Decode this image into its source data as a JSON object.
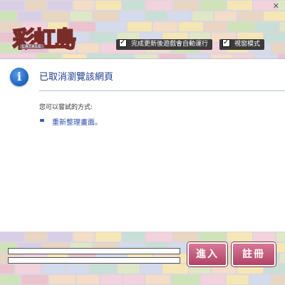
{
  "colors": {
    "brick_palette": [
      "#f2d2dd",
      "#cfe3b8",
      "#e8d5c2",
      "#d3dbec",
      "#f5e7b5",
      "#d8cfe6",
      "#eac3cf",
      "#c7dfd6",
      "#f3ddc9",
      "#dfe8c6"
    ],
    "accent": "#b24365",
    "link": "#2d4ea8"
  },
  "header": {
    "logo_text": "彩虹島",
    "logo_subtext": "LATALE",
    "option_autorun": {
      "label": "完成更新後遊戲會自動運行",
      "checked": true
    },
    "option_window": {
      "label": "視窗模式",
      "checked": true
    },
    "close_glyph": "✕"
  },
  "content": {
    "icon": "info-icon",
    "icon_glyph": "i",
    "heading": "已取消瀏覽該網頁",
    "suggestion": "您可以嘗試的方式:",
    "link_text": "重新整理畫面。"
  },
  "footer": {
    "enter_button": "進入",
    "register_button": "註冊"
  }
}
